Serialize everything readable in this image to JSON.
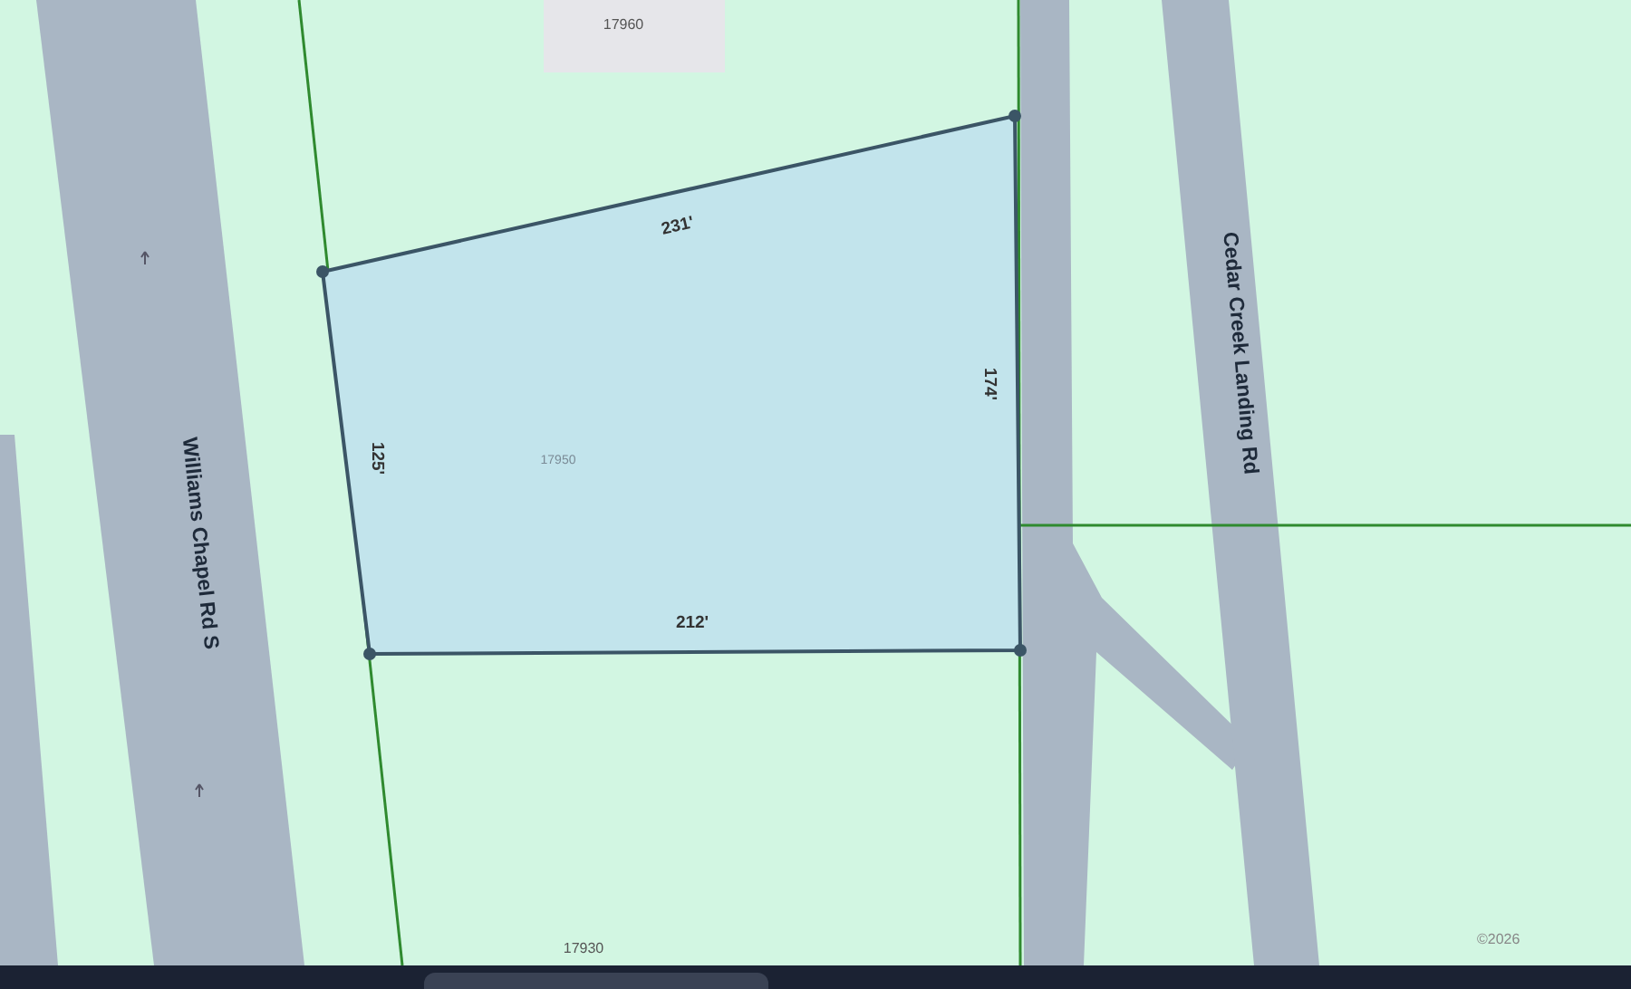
{
  "map": {
    "streets": [
      {
        "name": "Williams Chapel Rd S"
      },
      {
        "name": "Cedar Creek Landing Rd"
      }
    ],
    "neighbor_lots": [
      "17960",
      "17930"
    ],
    "parcel": {
      "lot": "17950",
      "sides": [
        "231'",
        "174'",
        "212'",
        "125'"
      ]
    },
    "attribution": "©2026"
  }
}
